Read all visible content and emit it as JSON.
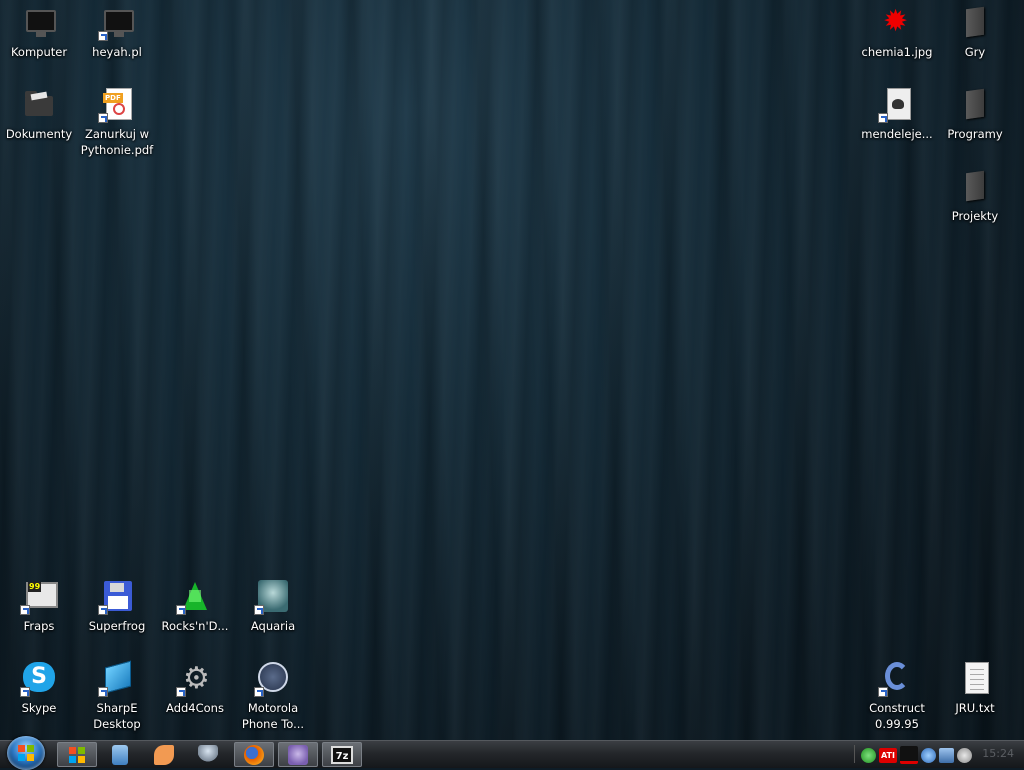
{
  "desktop": {
    "icons": [
      {
        "label": "Komputer"
      },
      {
        "label": "heyah.pl"
      },
      {
        "label": "Dokumenty"
      },
      {
        "label": "Zanurkuj w Pythonie.pdf"
      },
      {
        "label": "chemia1.jpg"
      },
      {
        "label": "Gry"
      },
      {
        "label": "mendeleje..."
      },
      {
        "label": "Programy"
      },
      {
        "label": "Projekty"
      },
      {
        "label": "Fraps"
      },
      {
        "label": "Superfrog"
      },
      {
        "label": "Rocks'n'D..."
      },
      {
        "label": "Aquaria"
      },
      {
        "label": "Skype"
      },
      {
        "label": "SharpE Desktop"
      },
      {
        "label": "Add4Cons"
      },
      {
        "label": "Motorola Phone To..."
      },
      {
        "label": "Construct 0.99.95"
      },
      {
        "label": "JRU.txt"
      }
    ]
  },
  "taskbar": {
    "buttons": [
      {
        "icon": "windows-explorer-icon"
      },
      {
        "icon": "notepad-icon"
      },
      {
        "icon": "media-player-icon"
      },
      {
        "icon": "network-icon"
      },
      {
        "icon": "firefox-icon"
      },
      {
        "icon": "pidgin-icon"
      },
      {
        "icon": "7zip-icon",
        "text": "7z"
      }
    ],
    "tray": [
      {
        "icon": "show-hidden-icon"
      },
      {
        "icon": "green-status-icon"
      },
      {
        "icon": "ati-icon",
        "text": "ATI"
      },
      {
        "icon": "cpu-graph-icon"
      },
      {
        "icon": "power-icon"
      },
      {
        "icon": "network-monitor-icon"
      },
      {
        "icon": "volume-icon"
      }
    ],
    "clock": "15:24"
  }
}
